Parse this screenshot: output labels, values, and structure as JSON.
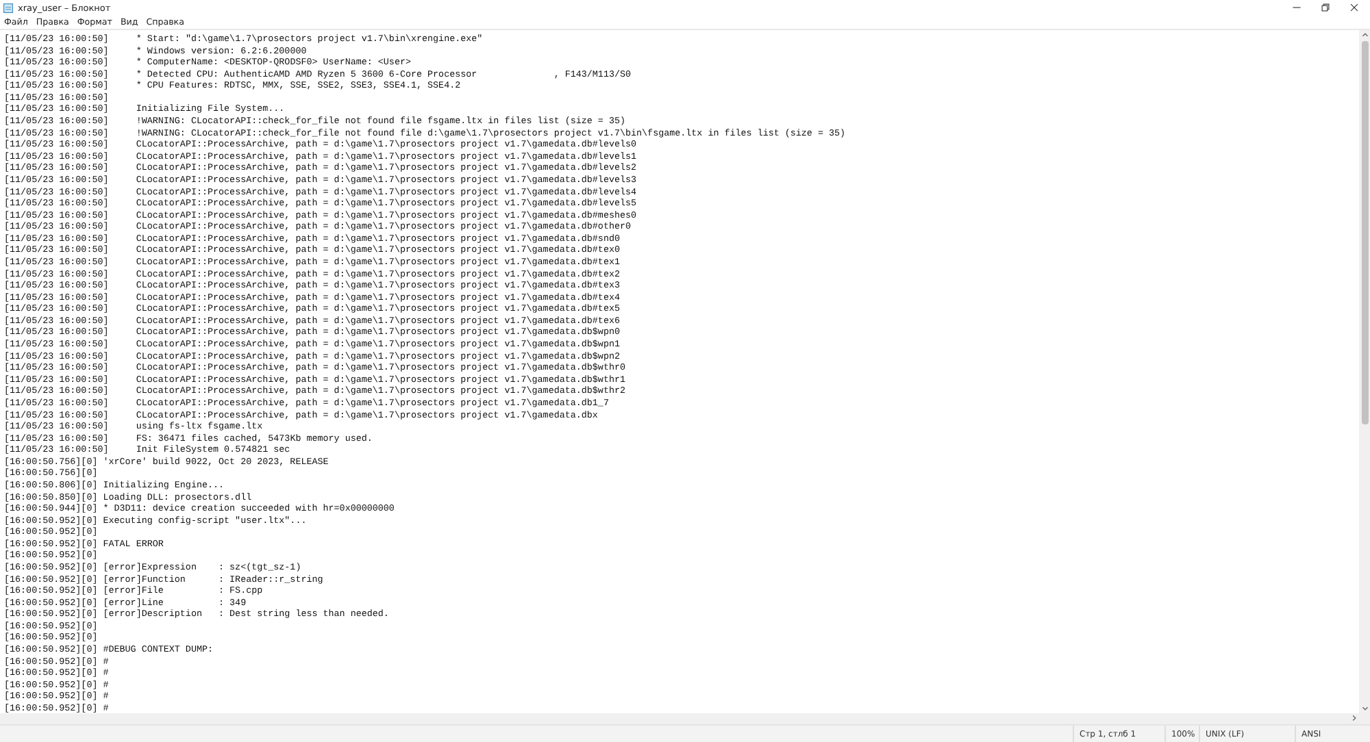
{
  "window": {
    "title": "xray_user – Блокнот"
  },
  "menu": [
    "Файл",
    "Правка",
    "Формат",
    "Вид",
    "Справка"
  ],
  "lines": [
    "[11/05/23 16:00:50]\t* Start: \"d:\\game\\1.7\\prosectors project v1.7\\bin\\xrengine.exe\"",
    "[11/05/23 16:00:50]\t* Windows version: 6.2:6.200000",
    "[11/05/23 16:00:50]\t* ComputerName: <DESKTOP-QRODSF0> UserName: <User>",
    "[11/05/23 16:00:50]\t* Detected CPU: AuthenticAMD AMD Ryzen 5 3600 6-Core Processor              , F143/M113/S0",
    "[11/05/23 16:00:50]\t* CPU Features: RDTSC, MMX, SSE, SSE2, SSE3, SSE4.1, SSE4.2",
    "[11/05/23 16:00:50]",
    "[11/05/23 16:00:50]\tInitializing File System...",
    "[11/05/23 16:00:50]\t!WARNING: CLocatorAPI::check_for_file not found file fsgame.ltx in files list (size = 35)",
    "[11/05/23 16:00:50]\t!WARNING: CLocatorAPI::check_for_file not found file d:\\game\\1.7\\prosectors project v1.7\\bin\\fsgame.ltx in files list (size = 35)",
    "[11/05/23 16:00:50]\tCLocatorAPI::ProcessArchive, path = d:\\game\\1.7\\prosectors project v1.7\\gamedata.db#levels0",
    "[11/05/23 16:00:50]\tCLocatorAPI::ProcessArchive, path = d:\\game\\1.7\\prosectors project v1.7\\gamedata.db#levels1",
    "[11/05/23 16:00:50]\tCLocatorAPI::ProcessArchive, path = d:\\game\\1.7\\prosectors project v1.7\\gamedata.db#levels2",
    "[11/05/23 16:00:50]\tCLocatorAPI::ProcessArchive, path = d:\\game\\1.7\\prosectors project v1.7\\gamedata.db#levels3",
    "[11/05/23 16:00:50]\tCLocatorAPI::ProcessArchive, path = d:\\game\\1.7\\prosectors project v1.7\\gamedata.db#levels4",
    "[11/05/23 16:00:50]\tCLocatorAPI::ProcessArchive, path = d:\\game\\1.7\\prosectors project v1.7\\gamedata.db#levels5",
    "[11/05/23 16:00:50]\tCLocatorAPI::ProcessArchive, path = d:\\game\\1.7\\prosectors project v1.7\\gamedata.db#meshes0",
    "[11/05/23 16:00:50]\tCLocatorAPI::ProcessArchive, path = d:\\game\\1.7\\prosectors project v1.7\\gamedata.db#other0",
    "[11/05/23 16:00:50]\tCLocatorAPI::ProcessArchive, path = d:\\game\\1.7\\prosectors project v1.7\\gamedata.db#snd0",
    "[11/05/23 16:00:50]\tCLocatorAPI::ProcessArchive, path = d:\\game\\1.7\\prosectors project v1.7\\gamedata.db#tex0",
    "[11/05/23 16:00:50]\tCLocatorAPI::ProcessArchive, path = d:\\game\\1.7\\prosectors project v1.7\\gamedata.db#tex1",
    "[11/05/23 16:00:50]\tCLocatorAPI::ProcessArchive, path = d:\\game\\1.7\\prosectors project v1.7\\gamedata.db#tex2",
    "[11/05/23 16:00:50]\tCLocatorAPI::ProcessArchive, path = d:\\game\\1.7\\prosectors project v1.7\\gamedata.db#tex3",
    "[11/05/23 16:00:50]\tCLocatorAPI::ProcessArchive, path = d:\\game\\1.7\\prosectors project v1.7\\gamedata.db#tex4",
    "[11/05/23 16:00:50]\tCLocatorAPI::ProcessArchive, path = d:\\game\\1.7\\prosectors project v1.7\\gamedata.db#tex5",
    "[11/05/23 16:00:50]\tCLocatorAPI::ProcessArchive, path = d:\\game\\1.7\\prosectors project v1.7\\gamedata.db#tex6",
    "[11/05/23 16:00:50]\tCLocatorAPI::ProcessArchive, path = d:\\game\\1.7\\prosectors project v1.7\\gamedata.db$wpn0",
    "[11/05/23 16:00:50]\tCLocatorAPI::ProcessArchive, path = d:\\game\\1.7\\prosectors project v1.7\\gamedata.db$wpn1",
    "[11/05/23 16:00:50]\tCLocatorAPI::ProcessArchive, path = d:\\game\\1.7\\prosectors project v1.7\\gamedata.db$wpn2",
    "[11/05/23 16:00:50]\tCLocatorAPI::ProcessArchive, path = d:\\game\\1.7\\prosectors project v1.7\\gamedata.db$wthr0",
    "[11/05/23 16:00:50]\tCLocatorAPI::ProcessArchive, path = d:\\game\\1.7\\prosectors project v1.7\\gamedata.db$wthr1",
    "[11/05/23 16:00:50]\tCLocatorAPI::ProcessArchive, path = d:\\game\\1.7\\prosectors project v1.7\\gamedata.db$wthr2",
    "[11/05/23 16:00:50]\tCLocatorAPI::ProcessArchive, path = d:\\game\\1.7\\prosectors project v1.7\\gamedata.db1_7",
    "[11/05/23 16:00:50]\tCLocatorAPI::ProcessArchive, path = d:\\game\\1.7\\prosectors project v1.7\\gamedata.dbx",
    "[11/05/23 16:00:50]\tusing fs-ltx fsgame.ltx",
    "[11/05/23 16:00:50]\tFS: 36471 files cached, 5473Kb memory used.",
    "[11/05/23 16:00:50]\tInit FileSystem 0.574821 sec",
    "[16:00:50.756][0] 'xrCore' build 9022, Oct 20 2023, RELEASE",
    "[16:00:50.756][0]",
    "[16:00:50.806][0] Initializing Engine...",
    "[16:00:50.850][0] Loading DLL: prosectors.dll",
    "[16:00:50.944][0] * D3D11: device creation succeeded with hr=0x00000000",
    "[16:00:50.952][0] Executing config-script \"user.ltx\"...",
    "[16:00:50.952][0]",
    "[16:00:50.952][0] FATAL ERROR",
    "[16:00:50.952][0]",
    "[16:00:50.952][0] [error]Expression    : sz<(tgt_sz-1)",
    "[16:00:50.952][0] [error]Function      : IReader::r_string",
    "[16:00:50.952][0] [error]File          : FS.cpp",
    "[16:00:50.952][0] [error]Line          : 349",
    "[16:00:50.952][0] [error]Description   : Dest string less than needed.",
    "[16:00:50.952][0]",
    "[16:00:50.952][0]",
    "[16:00:50.952][0] #DEBUG CONTEXT DUMP:",
    "[16:00:50.952][0] #",
    "[16:00:50.952][0] #",
    "[16:00:50.952][0] #",
    "[16:00:50.952][0] #",
    "[16:00:50.952][0] #"
  ],
  "status_bar": {
    "position": "Стр 1, стлб 1",
    "zoom": "100%",
    "line_endings": "UNIX (LF)",
    "encoding": "ANSI"
  }
}
